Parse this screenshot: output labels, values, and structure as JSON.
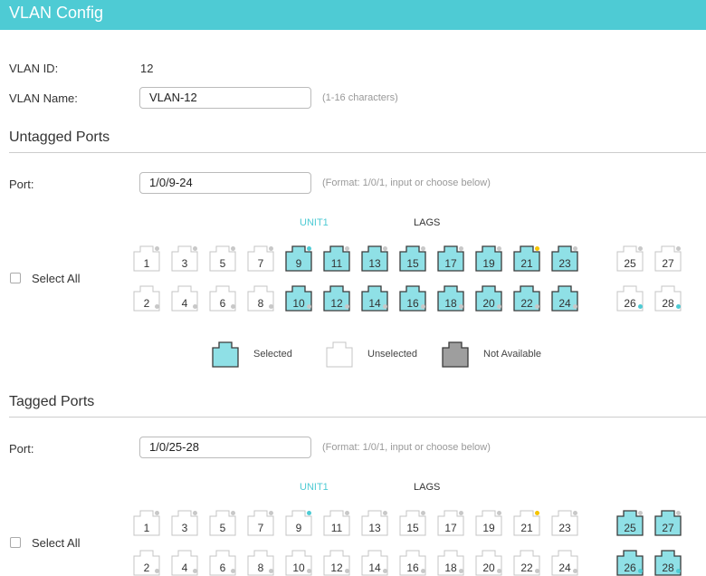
{
  "header": {
    "title": "VLAN Config"
  },
  "colors": {
    "accent": "#4ecbd4",
    "selected_fill": "#8fe0e6",
    "unavailable_fill": "#9e9e9e",
    "link_dot": "#4ecbd4",
    "warn_dot": "#f5c400",
    "idle_dot": "#c8c8c8"
  },
  "vlan": {
    "id_label": "VLAN ID:",
    "id_value": "12",
    "name_label": "VLAN Name:",
    "name_value": "VLAN-12",
    "name_hint": "(1-16 characters)"
  },
  "untagged": {
    "title": "Untagged Ports",
    "port_label": "Port:",
    "port_value": "1/0/9-24",
    "port_hint": "(Format: 1/0/1, input or choose below)",
    "tab_unit": "UNIT1",
    "tab_lags": "LAGS",
    "select_all": "Select All",
    "selected_ports": [
      9,
      10,
      11,
      12,
      13,
      14,
      15,
      16,
      17,
      18,
      19,
      20,
      21,
      22,
      23,
      24
    ],
    "unavailable_ports": []
  },
  "legend": {
    "selected": "Selected",
    "unselected": "Unselected",
    "not_available": "Not Available"
  },
  "tagged": {
    "title": "Tagged Ports",
    "port_label": "Port:",
    "port_value": "1/0/25-28",
    "port_hint": "(Format: 1/0/1, input or choose below)",
    "tab_unit": "UNIT1",
    "tab_lags": "LAGS",
    "select_all": "Select All",
    "selected_ports": [
      25,
      26,
      27,
      28
    ],
    "unavailable_ports": []
  },
  "port_status": {
    "link_up": [
      9,
      26,
      28
    ],
    "warning": [
      21
    ]
  }
}
